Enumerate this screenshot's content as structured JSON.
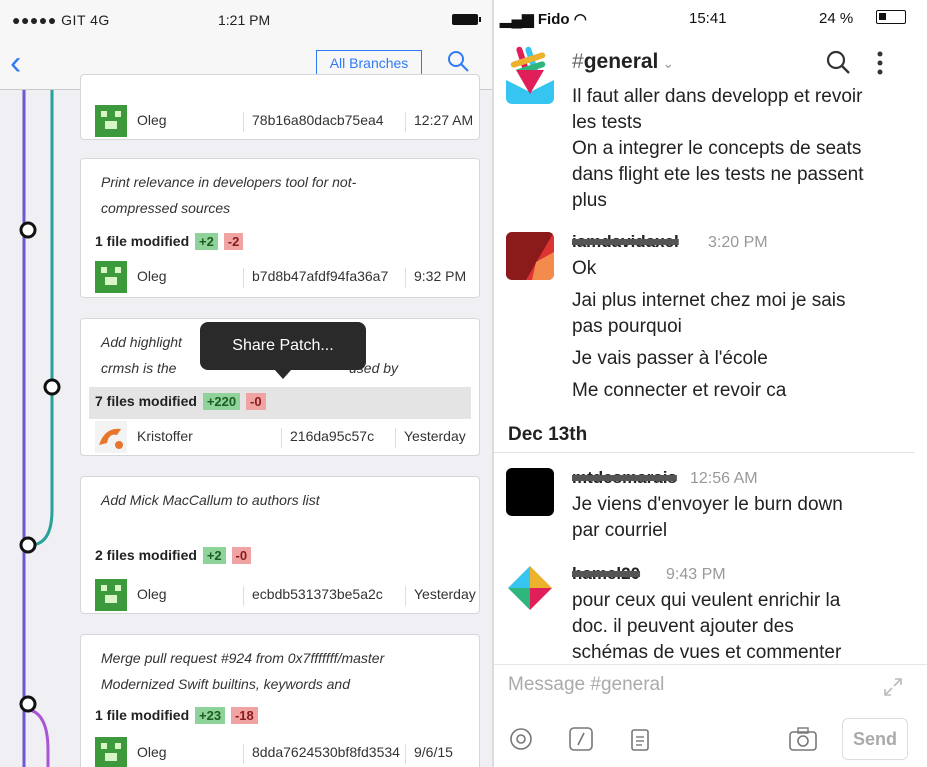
{
  "left_app": {
    "status": {
      "carrier": "●●●●● GIT  4G",
      "time": "1:21 PM"
    },
    "nav": {
      "branches_label": "All Branches"
    },
    "commits": [
      {
        "message": "",
        "files": "",
        "add": "",
        "del": "",
        "author": "Oleg",
        "sha": "78b16a80dacb75ea4",
        "when": "12:27 AM"
      },
      {
        "message_lines": [
          "Print relevance in developers tool for not-",
          "compressed sources"
        ],
        "files": "1 file modified",
        "add": "+2",
        "del": "-2",
        "author": "Oleg",
        "sha": "b7d8b47afdf94fa36a7",
        "when": "9:32 PM"
      },
      {
        "message_lines": [
          "Add highlight",
          "crmsh is the"
        ],
        "message_tail": "used by",
        "files": "7 files modified",
        "add": "+220",
        "del": "-0",
        "author": "Kristoffer",
        "sha": "216da95c57c",
        "when": "Yesterday"
      },
      {
        "message_lines": [
          "Add Mick MacCallum to authors list"
        ],
        "files": "2 files modified",
        "add": "+2",
        "del": "-0",
        "author": "Oleg",
        "sha": "ecbdb531373be5a2c",
        "when": "Yesterday"
      },
      {
        "message_lines": [
          "Merge pull request #924 from 0x7fffffff/master",
          "Modernized Swift builtins, keywords and"
        ],
        "files": "1 file modified",
        "add": "+23",
        "del": "-18",
        "author": "Oleg",
        "sha": "8dda7624530bf8fd3534",
        "when": "9/6/15"
      }
    ],
    "tooltip": "Share Patch..."
  },
  "right_app": {
    "status": {
      "carrier": "Fido",
      "time": "15:41",
      "battery": "24 %"
    },
    "channel": {
      "hash": "#",
      "name": "general",
      "chevron": "⌄"
    },
    "messages": [
      {
        "lines": [
          "Il faut aller dans developp et revoir",
          "les tests",
          "On a integrer le concepts de seats",
          "dans flight ete les tests ne passent",
          "plus"
        ]
      },
      {
        "user": "iamdavidaxel",
        "time": "3:20 PM",
        "lines": [
          "Ok",
          "Jai plus internet chez moi je sais",
          "pas pourquoi",
          "Je vais passer à l'école",
          "Me connecter et revoir ca"
        ]
      },
      {
        "user": "mtdesmarais",
        "time": "12:56 AM",
        "lines": [
          "Je viens d'envoyer le burn down",
          "par courriel"
        ]
      },
      {
        "user": "hamel20",
        "time": "9:43 PM",
        "lines": [
          "pour ceux qui veulent enrichir la",
          "doc. il  peuvent ajouter des",
          "schémas de vues et commenter"
        ]
      }
    ],
    "day_separator": "Dec 13th",
    "composer_placeholder": "Message #general",
    "send_label": "Send"
  }
}
